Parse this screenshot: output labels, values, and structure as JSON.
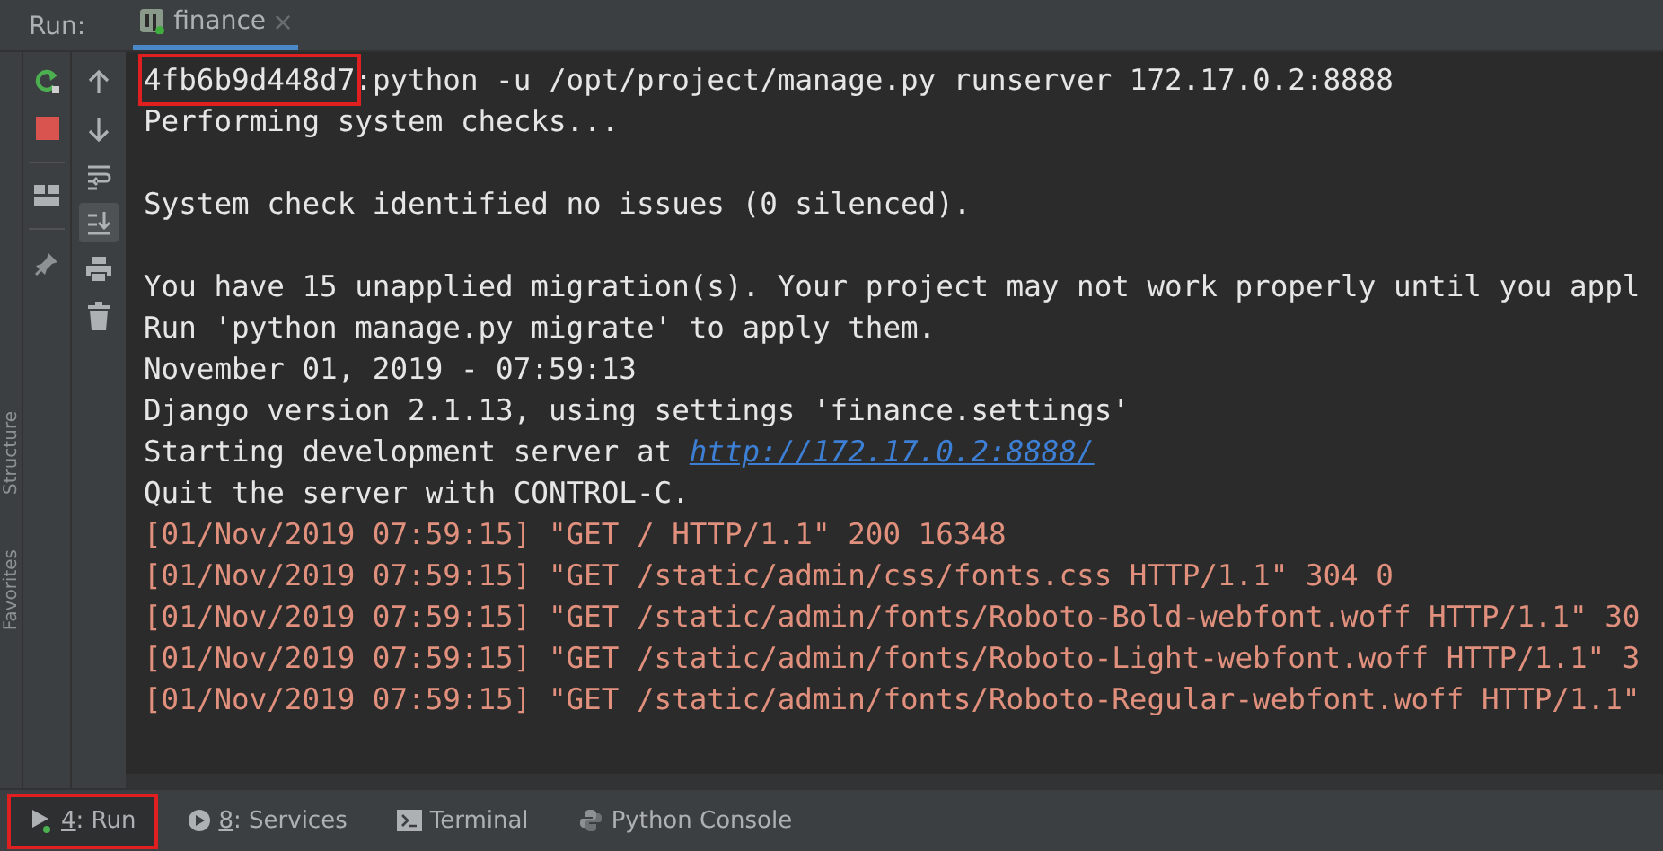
{
  "run_header": {
    "label": "Run:",
    "tabs": [
      {
        "label": "finance",
        "selected": true
      }
    ]
  },
  "side_tools": [
    "Structure",
    "Favorites"
  ],
  "toolbar": {
    "items": [
      {
        "kind": "up",
        "selected": false
      },
      {
        "kind": "down",
        "selected": false
      },
      {
        "kind": "wrap",
        "selected": false
      },
      {
        "kind": "scroll-end",
        "selected": true
      },
      {
        "kind": "print",
        "selected": false
      },
      {
        "kind": "trash",
        "selected": false
      }
    ]
  },
  "console": {
    "lines": [
      {
        "kind": "out",
        "tag": "4fb6b9d448d7",
        "highlighted": true,
        "text": ":python -u /opt/project/manage.py runserver 172.17.0.2:8888"
      },
      {
        "kind": "out",
        "text": "Performing system checks..."
      },
      {
        "kind": "blank"
      },
      {
        "kind": "out",
        "text": "System check identified no issues (0 silenced)."
      },
      {
        "kind": "blank"
      },
      {
        "kind": "out",
        "text": "You have 15 unapplied migration(s). Your project may not work properly until you appl"
      },
      {
        "kind": "out",
        "text": "Run 'python manage.py migrate' to apply them."
      },
      {
        "kind": "out",
        "text": "November 01, 2019 - 07:59:13"
      },
      {
        "kind": "out",
        "text": "Django version 2.1.13, using settings 'finance.settings'"
      },
      {
        "kind": "out",
        "text": "Starting development server at ",
        "link": "http://172.17.0.2:8888/"
      },
      {
        "kind": "out",
        "text": "Quit the server with CONTROL-C."
      },
      {
        "kind": "err",
        "text": "[01/Nov/2019 07:59:15] \"GET / HTTP/1.1\" 200 16348"
      },
      {
        "kind": "err",
        "text": "[01/Nov/2019 07:59:15] \"GET /static/admin/css/fonts.css HTTP/1.1\" 304 0"
      },
      {
        "kind": "err",
        "text": "[01/Nov/2019 07:59:15] \"GET /static/admin/fonts/Roboto-Bold-webfont.woff HTTP/1.1\" 30"
      },
      {
        "kind": "err",
        "text": "[01/Nov/2019 07:59:15] \"GET /static/admin/fonts/Roboto-Light-webfont.woff HTTP/1.1\" 3"
      },
      {
        "kind": "err",
        "text": "[01/Nov/2019 07:59:15] \"GET /static/admin/fonts/Roboto-Regular-webfont.woff HTTP/1.1\""
      }
    ]
  },
  "bottom_tabs": [
    {
      "kind": "run",
      "key": "4",
      "label": ": Run",
      "selected": true,
      "highlighted": true
    },
    {
      "kind": "services",
      "key": "8",
      "label": ": Services",
      "selected": false,
      "highlighted": false
    },
    {
      "kind": "terminal",
      "label": "Terminal",
      "selected": false,
      "highlighted": false
    },
    {
      "kind": "python",
      "label": "Python Console",
      "selected": false,
      "highlighted": false
    }
  ]
}
